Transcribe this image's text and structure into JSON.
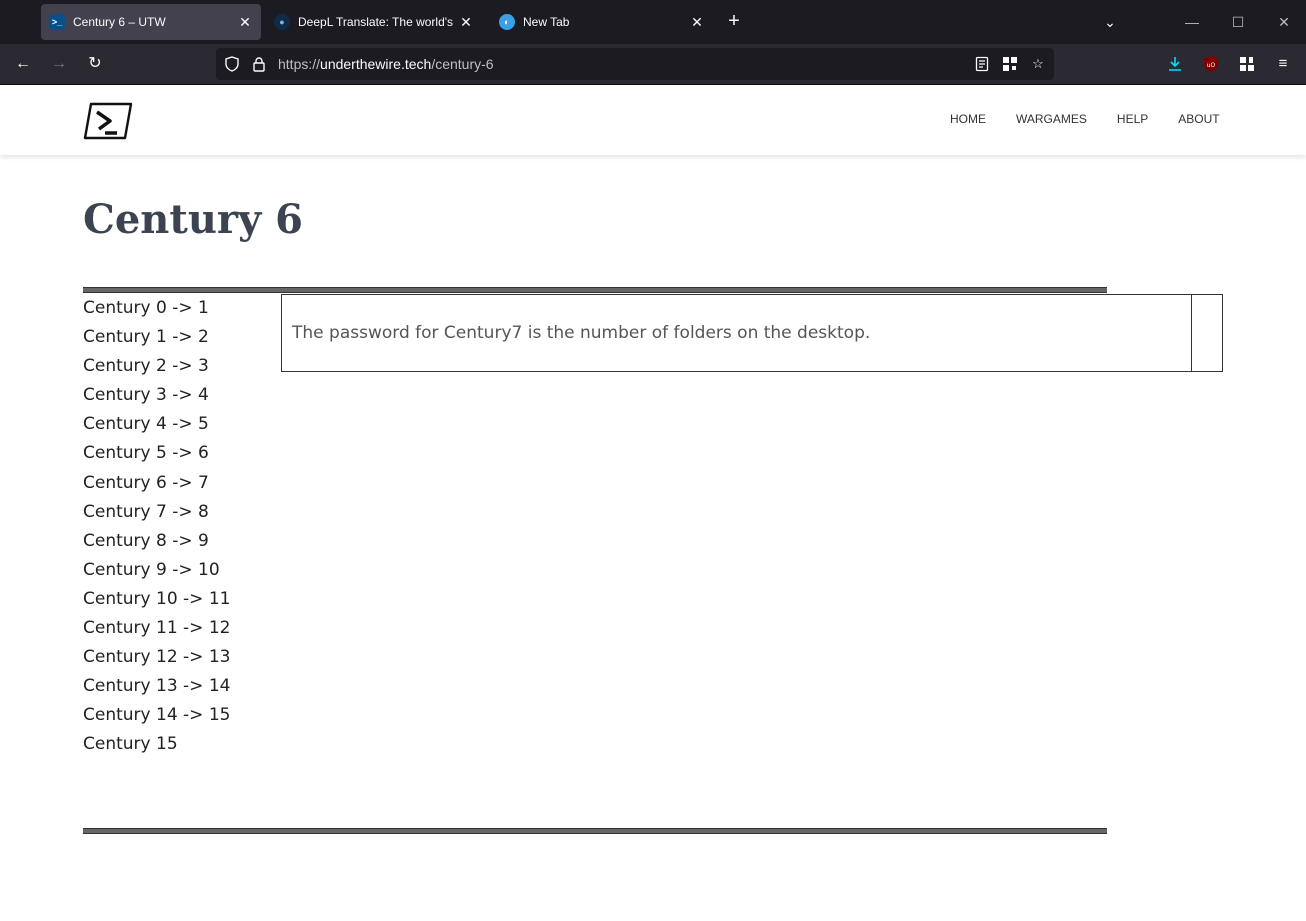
{
  "browser": {
    "tabs": [
      {
        "title": "Century 6 – UTW",
        "active": true,
        "icon": "powershell-icon"
      },
      {
        "title": "DeepL Translate: The world's mo",
        "active": false,
        "icon": "deepl-icon"
      },
      {
        "title": "New Tab",
        "active": false,
        "icon": "firefox-icon"
      }
    ],
    "url": {
      "scheme": "https://",
      "host": "underthewire.tech",
      "path": "/century-6"
    },
    "accent_color": "#00ddff"
  },
  "site": {
    "nav": [
      "HOME",
      "WARGAMES",
      "HELP",
      "ABOUT"
    ],
    "page_title": "Century 6",
    "levels": [
      "Century 0 -> 1",
      "Century 1 -> 2",
      "Century 2 -> 3",
      "Century 3 -> 4",
      "Century 4 -> 5",
      "Century 5 -> 6",
      "Century 6 -> 7",
      "Century 7 -> 8",
      "Century 8 -> 9",
      "Century 9 -> 10",
      "Century 10 -> 11",
      "Century 11 -> 12",
      "Century 12 -> 13",
      "Century 13 -> 14",
      "Century 14 -> 15",
      "Century 15"
    ],
    "description": "The password for Century7 is the number of folders on the desktop."
  }
}
